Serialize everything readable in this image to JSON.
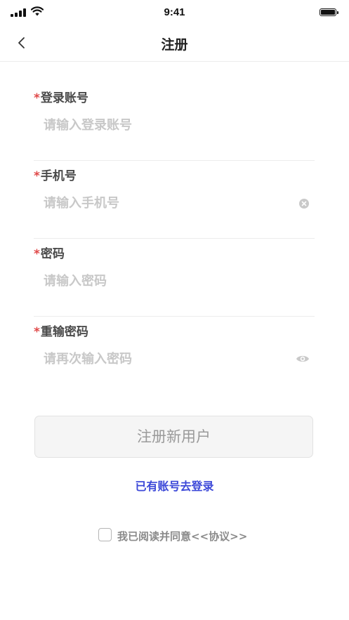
{
  "status_bar": {
    "time": "9:41"
  },
  "nav": {
    "title": "注册"
  },
  "form": {
    "required_mark": "*",
    "account": {
      "label": "登录账号",
      "placeholder": "请输入登录账号",
      "value": ""
    },
    "phone": {
      "label": "手机号",
      "placeholder": "请输入手机号",
      "value": ""
    },
    "password": {
      "label": "密码",
      "placeholder": "请输入密码",
      "value": ""
    },
    "confirm_password": {
      "label": "重输密码",
      "placeholder": "请再次输入密码",
      "value": ""
    }
  },
  "actions": {
    "register_label": "注册新用户",
    "login_link": "已有账号去登录"
  },
  "agreement": {
    "text": "我已阅读并同意<<协议>>",
    "checked": false
  },
  "icons": {
    "back": "chevron-left-icon",
    "clear": "clear-circle-icon",
    "password_toggle": "eye-icon",
    "signal": "signal-icon",
    "wifi": "wifi-icon",
    "battery": "battery-icon"
  },
  "colors": {
    "required": "#e04848",
    "link": "#3c48d8",
    "placeholder": "#c8c8c8",
    "button_bg": "#f5f5f5"
  }
}
